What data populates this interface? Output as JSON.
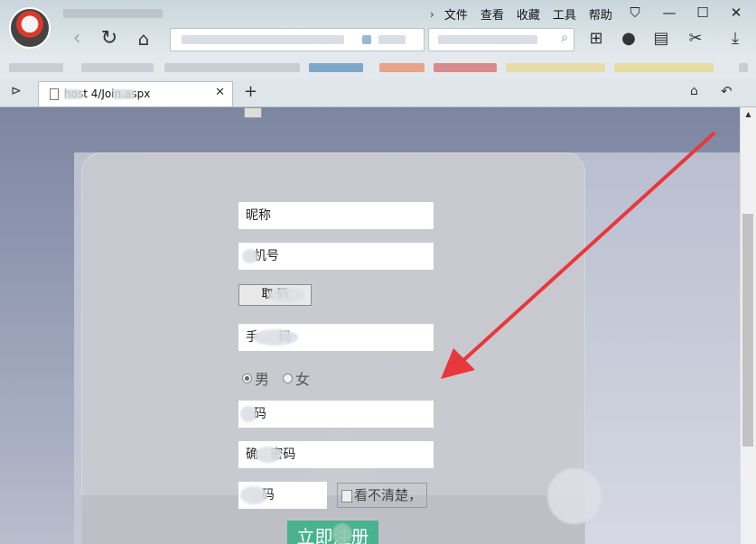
{
  "window": {
    "menu": [
      "文件",
      "查看",
      "收藏",
      "工具",
      "帮助"
    ]
  },
  "tab": {
    "title": "  host  4/Join.aspx"
  },
  "form": {
    "nickname_placeholder": "昵称",
    "phone_placeholder": "  机号",
    "get_code_label": "取   码",
    "phone_code_placeholder": "手     码",
    "gender_options": [
      "男",
      "女"
    ],
    "password_placeholder": "  码",
    "confirm_password_placeholder": "确   密码",
    "captcha_placeholder": "    码",
    "captcha_image_alt": "看不清楚，",
    "submit_label": "立即注册"
  },
  "colors": {
    "submit_button": "#49b28e",
    "annotation_arrow": "#e8383d",
    "page_background": "#939bb3"
  }
}
